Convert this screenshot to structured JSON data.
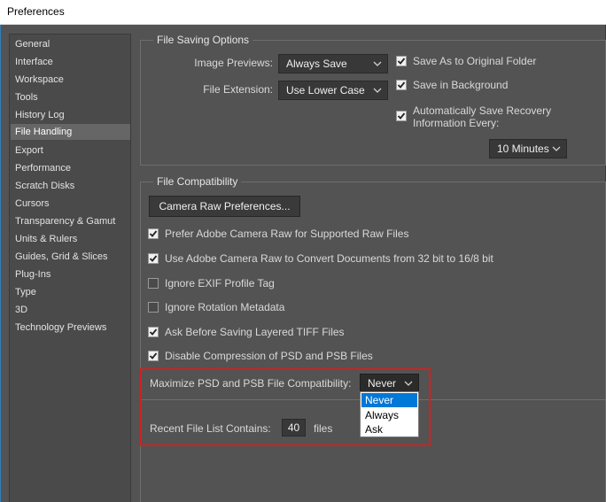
{
  "window": {
    "title": "Preferences"
  },
  "sidebar": {
    "items": [
      {
        "label": "General"
      },
      {
        "label": "Interface"
      },
      {
        "label": "Workspace"
      },
      {
        "label": "Tools"
      },
      {
        "label": "History Log"
      },
      {
        "label": "File Handling",
        "selected": true
      },
      {
        "label": "Export"
      },
      {
        "label": "Performance"
      },
      {
        "label": "Scratch Disks"
      },
      {
        "label": "Cursors"
      },
      {
        "label": "Transparency & Gamut"
      },
      {
        "label": "Units & Rulers"
      },
      {
        "label": "Guides, Grid & Slices"
      },
      {
        "label": "Plug-Ins"
      },
      {
        "label": "Type"
      },
      {
        "label": "3D"
      },
      {
        "label": "Technology Previews"
      }
    ]
  },
  "file_saving": {
    "title": "File Saving Options",
    "image_previews_label": "Image Previews:",
    "image_previews_value": "Always Save",
    "file_extension_label": "File Extension:",
    "file_extension_value": "Use Lower Case",
    "save_as_original": {
      "label": "Save As to Original Folder",
      "checked": true
    },
    "save_in_background": {
      "label": "Save in Background",
      "checked": true
    },
    "auto_save_recovery": {
      "label_line1": "Automatically Save Recovery",
      "label_line2": "Information Every:",
      "checked": true
    },
    "recovery_interval": "10 Minutes"
  },
  "file_compat": {
    "title": "File Compatibility",
    "camera_raw_button": "Camera Raw Preferences...",
    "options": [
      {
        "label": "Prefer Adobe Camera Raw for Supported Raw Files",
        "checked": true
      },
      {
        "label": "Use Adobe Camera Raw to Convert Documents from 32 bit to 16/8 bit",
        "checked": true
      },
      {
        "label": "Ignore EXIF Profile Tag",
        "checked": false
      },
      {
        "label": "Ignore Rotation Metadata",
        "checked": false
      },
      {
        "label": "Ask Before Saving Layered TIFF Files",
        "checked": true
      },
      {
        "label": "Disable Compression of PSD and PSB Files",
        "checked": true
      }
    ],
    "maximize_label": "Maximize PSD and PSB File Compatibility:",
    "maximize_value": "Never",
    "maximize_options": [
      "Never",
      "Always",
      "Ask"
    ],
    "recent_label": "Recent File List Contains:",
    "recent_value": "40",
    "recent_unit": "files"
  },
  "colors": {
    "background": "#535353",
    "highlight_border": "#d41f1f",
    "dropdown_selection": "#0078d7"
  }
}
